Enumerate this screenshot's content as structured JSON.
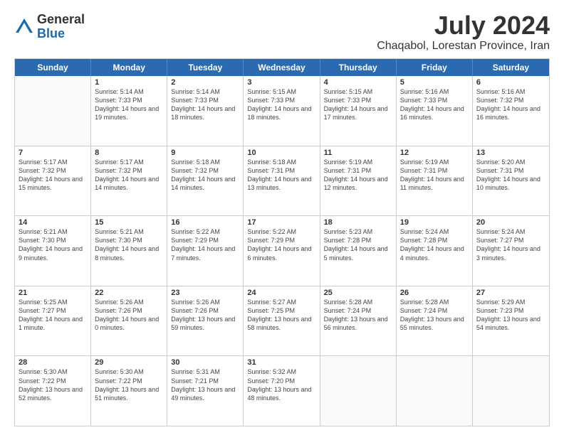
{
  "header": {
    "logo": {
      "general": "General",
      "blue": "Blue"
    },
    "title": "July 2024",
    "location": "Chaqabol, Lorestan Province, Iran"
  },
  "days_of_week": [
    "Sunday",
    "Monday",
    "Tuesday",
    "Wednesday",
    "Thursday",
    "Friday",
    "Saturday"
  ],
  "weeks": [
    [
      {
        "num": "",
        "empty": true
      },
      {
        "num": "1",
        "sunrise": "Sunrise: 5:14 AM",
        "sunset": "Sunset: 7:33 PM",
        "daylight": "Daylight: 14 hours and 19 minutes."
      },
      {
        "num": "2",
        "sunrise": "Sunrise: 5:14 AM",
        "sunset": "Sunset: 7:33 PM",
        "daylight": "Daylight: 14 hours and 18 minutes."
      },
      {
        "num": "3",
        "sunrise": "Sunrise: 5:15 AM",
        "sunset": "Sunset: 7:33 PM",
        "daylight": "Daylight: 14 hours and 18 minutes."
      },
      {
        "num": "4",
        "sunrise": "Sunrise: 5:15 AM",
        "sunset": "Sunset: 7:33 PM",
        "daylight": "Daylight: 14 hours and 17 minutes."
      },
      {
        "num": "5",
        "sunrise": "Sunrise: 5:16 AM",
        "sunset": "Sunset: 7:33 PM",
        "daylight": "Daylight: 14 hours and 16 minutes."
      },
      {
        "num": "6",
        "sunrise": "Sunrise: 5:16 AM",
        "sunset": "Sunset: 7:32 PM",
        "daylight": "Daylight: 14 hours and 16 minutes."
      }
    ],
    [
      {
        "num": "7",
        "sunrise": "Sunrise: 5:17 AM",
        "sunset": "Sunset: 7:32 PM",
        "daylight": "Daylight: 14 hours and 15 minutes."
      },
      {
        "num": "8",
        "sunrise": "Sunrise: 5:17 AM",
        "sunset": "Sunset: 7:32 PM",
        "daylight": "Daylight: 14 hours and 14 minutes."
      },
      {
        "num": "9",
        "sunrise": "Sunrise: 5:18 AM",
        "sunset": "Sunset: 7:32 PM",
        "daylight": "Daylight: 14 hours and 14 minutes."
      },
      {
        "num": "10",
        "sunrise": "Sunrise: 5:18 AM",
        "sunset": "Sunset: 7:31 PM",
        "daylight": "Daylight: 14 hours and 13 minutes."
      },
      {
        "num": "11",
        "sunrise": "Sunrise: 5:19 AM",
        "sunset": "Sunset: 7:31 PM",
        "daylight": "Daylight: 14 hours and 12 minutes."
      },
      {
        "num": "12",
        "sunrise": "Sunrise: 5:19 AM",
        "sunset": "Sunset: 7:31 PM",
        "daylight": "Daylight: 14 hours and 11 minutes."
      },
      {
        "num": "13",
        "sunrise": "Sunrise: 5:20 AM",
        "sunset": "Sunset: 7:31 PM",
        "daylight": "Daylight: 14 hours and 10 minutes."
      }
    ],
    [
      {
        "num": "14",
        "sunrise": "Sunrise: 5:21 AM",
        "sunset": "Sunset: 7:30 PM",
        "daylight": "Daylight: 14 hours and 9 minutes."
      },
      {
        "num": "15",
        "sunrise": "Sunrise: 5:21 AM",
        "sunset": "Sunset: 7:30 PM",
        "daylight": "Daylight: 14 hours and 8 minutes."
      },
      {
        "num": "16",
        "sunrise": "Sunrise: 5:22 AM",
        "sunset": "Sunset: 7:29 PM",
        "daylight": "Daylight: 14 hours and 7 minutes."
      },
      {
        "num": "17",
        "sunrise": "Sunrise: 5:22 AM",
        "sunset": "Sunset: 7:29 PM",
        "daylight": "Daylight: 14 hours and 6 minutes."
      },
      {
        "num": "18",
        "sunrise": "Sunrise: 5:23 AM",
        "sunset": "Sunset: 7:28 PM",
        "daylight": "Daylight: 14 hours and 5 minutes."
      },
      {
        "num": "19",
        "sunrise": "Sunrise: 5:24 AM",
        "sunset": "Sunset: 7:28 PM",
        "daylight": "Daylight: 14 hours and 4 minutes."
      },
      {
        "num": "20",
        "sunrise": "Sunrise: 5:24 AM",
        "sunset": "Sunset: 7:27 PM",
        "daylight": "Daylight: 14 hours and 3 minutes."
      }
    ],
    [
      {
        "num": "21",
        "sunrise": "Sunrise: 5:25 AM",
        "sunset": "Sunset: 7:27 PM",
        "daylight": "Daylight: 14 hours and 1 minute."
      },
      {
        "num": "22",
        "sunrise": "Sunrise: 5:26 AM",
        "sunset": "Sunset: 7:26 PM",
        "daylight": "Daylight: 14 hours and 0 minutes."
      },
      {
        "num": "23",
        "sunrise": "Sunrise: 5:26 AM",
        "sunset": "Sunset: 7:26 PM",
        "daylight": "Daylight: 13 hours and 59 minutes."
      },
      {
        "num": "24",
        "sunrise": "Sunrise: 5:27 AM",
        "sunset": "Sunset: 7:25 PM",
        "daylight": "Daylight: 13 hours and 58 minutes."
      },
      {
        "num": "25",
        "sunrise": "Sunrise: 5:28 AM",
        "sunset": "Sunset: 7:24 PM",
        "daylight": "Daylight: 13 hours and 56 minutes."
      },
      {
        "num": "26",
        "sunrise": "Sunrise: 5:28 AM",
        "sunset": "Sunset: 7:24 PM",
        "daylight": "Daylight: 13 hours and 55 minutes."
      },
      {
        "num": "27",
        "sunrise": "Sunrise: 5:29 AM",
        "sunset": "Sunset: 7:23 PM",
        "daylight": "Daylight: 13 hours and 54 minutes."
      }
    ],
    [
      {
        "num": "28",
        "sunrise": "Sunrise: 5:30 AM",
        "sunset": "Sunset: 7:22 PM",
        "daylight": "Daylight: 13 hours and 52 minutes."
      },
      {
        "num": "29",
        "sunrise": "Sunrise: 5:30 AM",
        "sunset": "Sunset: 7:22 PM",
        "daylight": "Daylight: 13 hours and 51 minutes."
      },
      {
        "num": "30",
        "sunrise": "Sunrise: 5:31 AM",
        "sunset": "Sunset: 7:21 PM",
        "daylight": "Daylight: 13 hours and 49 minutes."
      },
      {
        "num": "31",
        "sunrise": "Sunrise: 5:32 AM",
        "sunset": "Sunset: 7:20 PM",
        "daylight": "Daylight: 13 hours and 48 minutes."
      },
      {
        "num": "",
        "empty": true
      },
      {
        "num": "",
        "empty": true
      },
      {
        "num": "",
        "empty": true
      }
    ]
  ]
}
